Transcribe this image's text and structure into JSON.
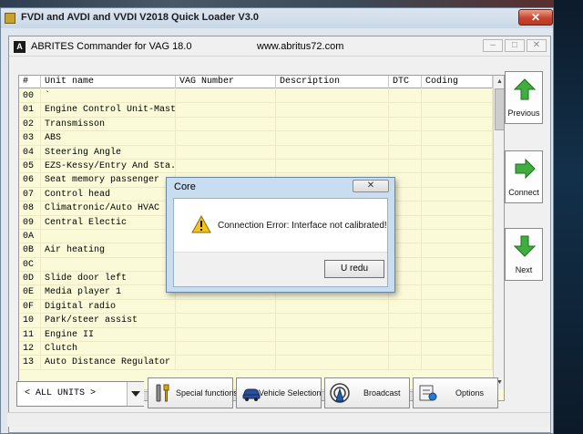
{
  "outer_window": {
    "title": "FVDI and AVDI and VVDI V2018 Quick Loader  V3.0",
    "close_label": "✕"
  },
  "app_window": {
    "logo_letter": "A",
    "title": "ABRITES Commander for VAG 18.0",
    "website": "www.abritus72.com",
    "minimize_label": "–",
    "maximize_label": "□",
    "close_label": "✕"
  },
  "table": {
    "columns": [
      "#",
      "Unit name",
      "VAG Number",
      "Description",
      "DTC",
      "Coding"
    ],
    "rows": [
      {
        "id": "00",
        "name": "`"
      },
      {
        "id": "01",
        "name": "Engine Control Unit-Master"
      },
      {
        "id": "02",
        "name": "Transmisson"
      },
      {
        "id": "03",
        "name": "ABS"
      },
      {
        "id": "04",
        "name": "Steering Angle"
      },
      {
        "id": "05",
        "name": "EZS-Kessy/Entry And Sta..."
      },
      {
        "id": "06",
        "name": "Seat memory passenger"
      },
      {
        "id": "07",
        "name": "Control head"
      },
      {
        "id": "08",
        "name": "Climatronic/Auto HVAC"
      },
      {
        "id": "09",
        "name": "Central Electic"
      },
      {
        "id": "0A",
        "name": ""
      },
      {
        "id": "0B",
        "name": "Air heating"
      },
      {
        "id": "0C",
        "name": ""
      },
      {
        "id": "0D",
        "name": "Slide door left"
      },
      {
        "id": "0E",
        "name": "Media player 1"
      },
      {
        "id": "0F",
        "name": "Digital radio"
      },
      {
        "id": "10",
        "name": "Park/steer assist"
      },
      {
        "id": "11",
        "name": "Engine II"
      },
      {
        "id": "12",
        "name": "Clutch"
      },
      {
        "id": "13",
        "name": "Auto Distance Regulator"
      }
    ]
  },
  "side_buttons": {
    "previous_label": "Previous",
    "connect_label": "Connect",
    "next_label": "Next"
  },
  "toolbar": {
    "units_value": "< ALL UNITS >",
    "special_functions_label": "Special functions",
    "vehicle_selection_label": "Vehicle Selection",
    "broadcast_label": "Broadcast",
    "options_label": "Options"
  },
  "dialog": {
    "title": "Core",
    "message": "Connection Error: Interface not calibrated!",
    "ok_label": "U redu",
    "close_label": "✕"
  },
  "colors": {
    "grid_background": "#fbfad8",
    "dialog_frame": "#c8ddf0",
    "arrow_green": "#3fae3f"
  }
}
